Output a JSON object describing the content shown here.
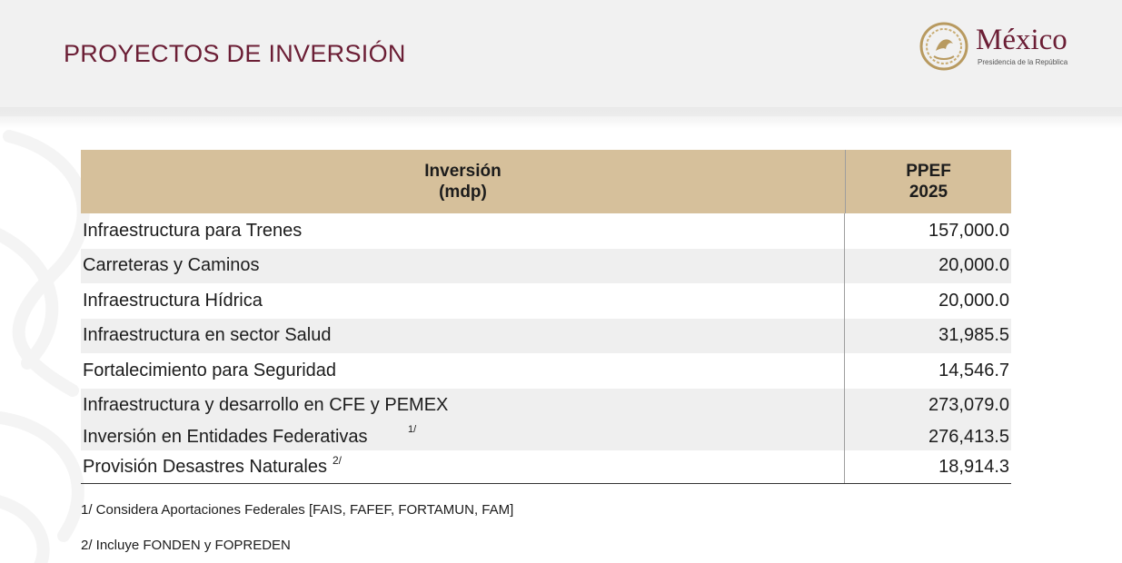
{
  "header": {
    "title": "PROYECTOS DE INVERSIÓN",
    "logo": {
      "wordmark": "México",
      "subtitle": "Presidencia de la República",
      "icon": "national-seal-icon"
    }
  },
  "table": {
    "columns": [
      "Inversión\n(mdp)",
      "PPEF\n2025"
    ],
    "header_col1_line1": "Inversión",
    "header_col1_line2": "(mdp)",
    "header_col2_line1": "PPEF",
    "header_col2_line2": "2025",
    "rows": [
      {
        "label": "Infraestructura para Trenes",
        "value": "157,000.0",
        "note": ""
      },
      {
        "label": "Carreteras y Caminos",
        "value": "20,000.0",
        "note": ""
      },
      {
        "label": "Infraestructura Hídrica",
        "value": "20,000.0",
        "note": ""
      },
      {
        "label": "Infraestructura en sector Salud",
        "value": "31,985.5",
        "note": ""
      },
      {
        "label": "Fortalecimiento para Seguridad",
        "value": "14,546.7",
        "note": ""
      },
      {
        "label": "Infraestructura y desarrollo en CFE y PEMEX",
        "value": "273,079.0",
        "note": ""
      },
      {
        "label": "Inversión en Entidades Federativas",
        "value": "276,413.5",
        "note": "1/"
      },
      {
        "label": "Provisión Desastres Naturales",
        "value": "18,914.3",
        "note": "2/"
      }
    ]
  },
  "footnotes": [
    "1/ Considera Aportaciones Federales [FAIS, FAFEF, FORTAMUN, FAM]",
    "2/ Incluye FONDEN y FOPREDEN"
  ],
  "colors": {
    "title": "#6b1e35",
    "header_fill": "#d6c09b",
    "row_shade": "#efefef",
    "band": "#f1f1f1"
  }
}
